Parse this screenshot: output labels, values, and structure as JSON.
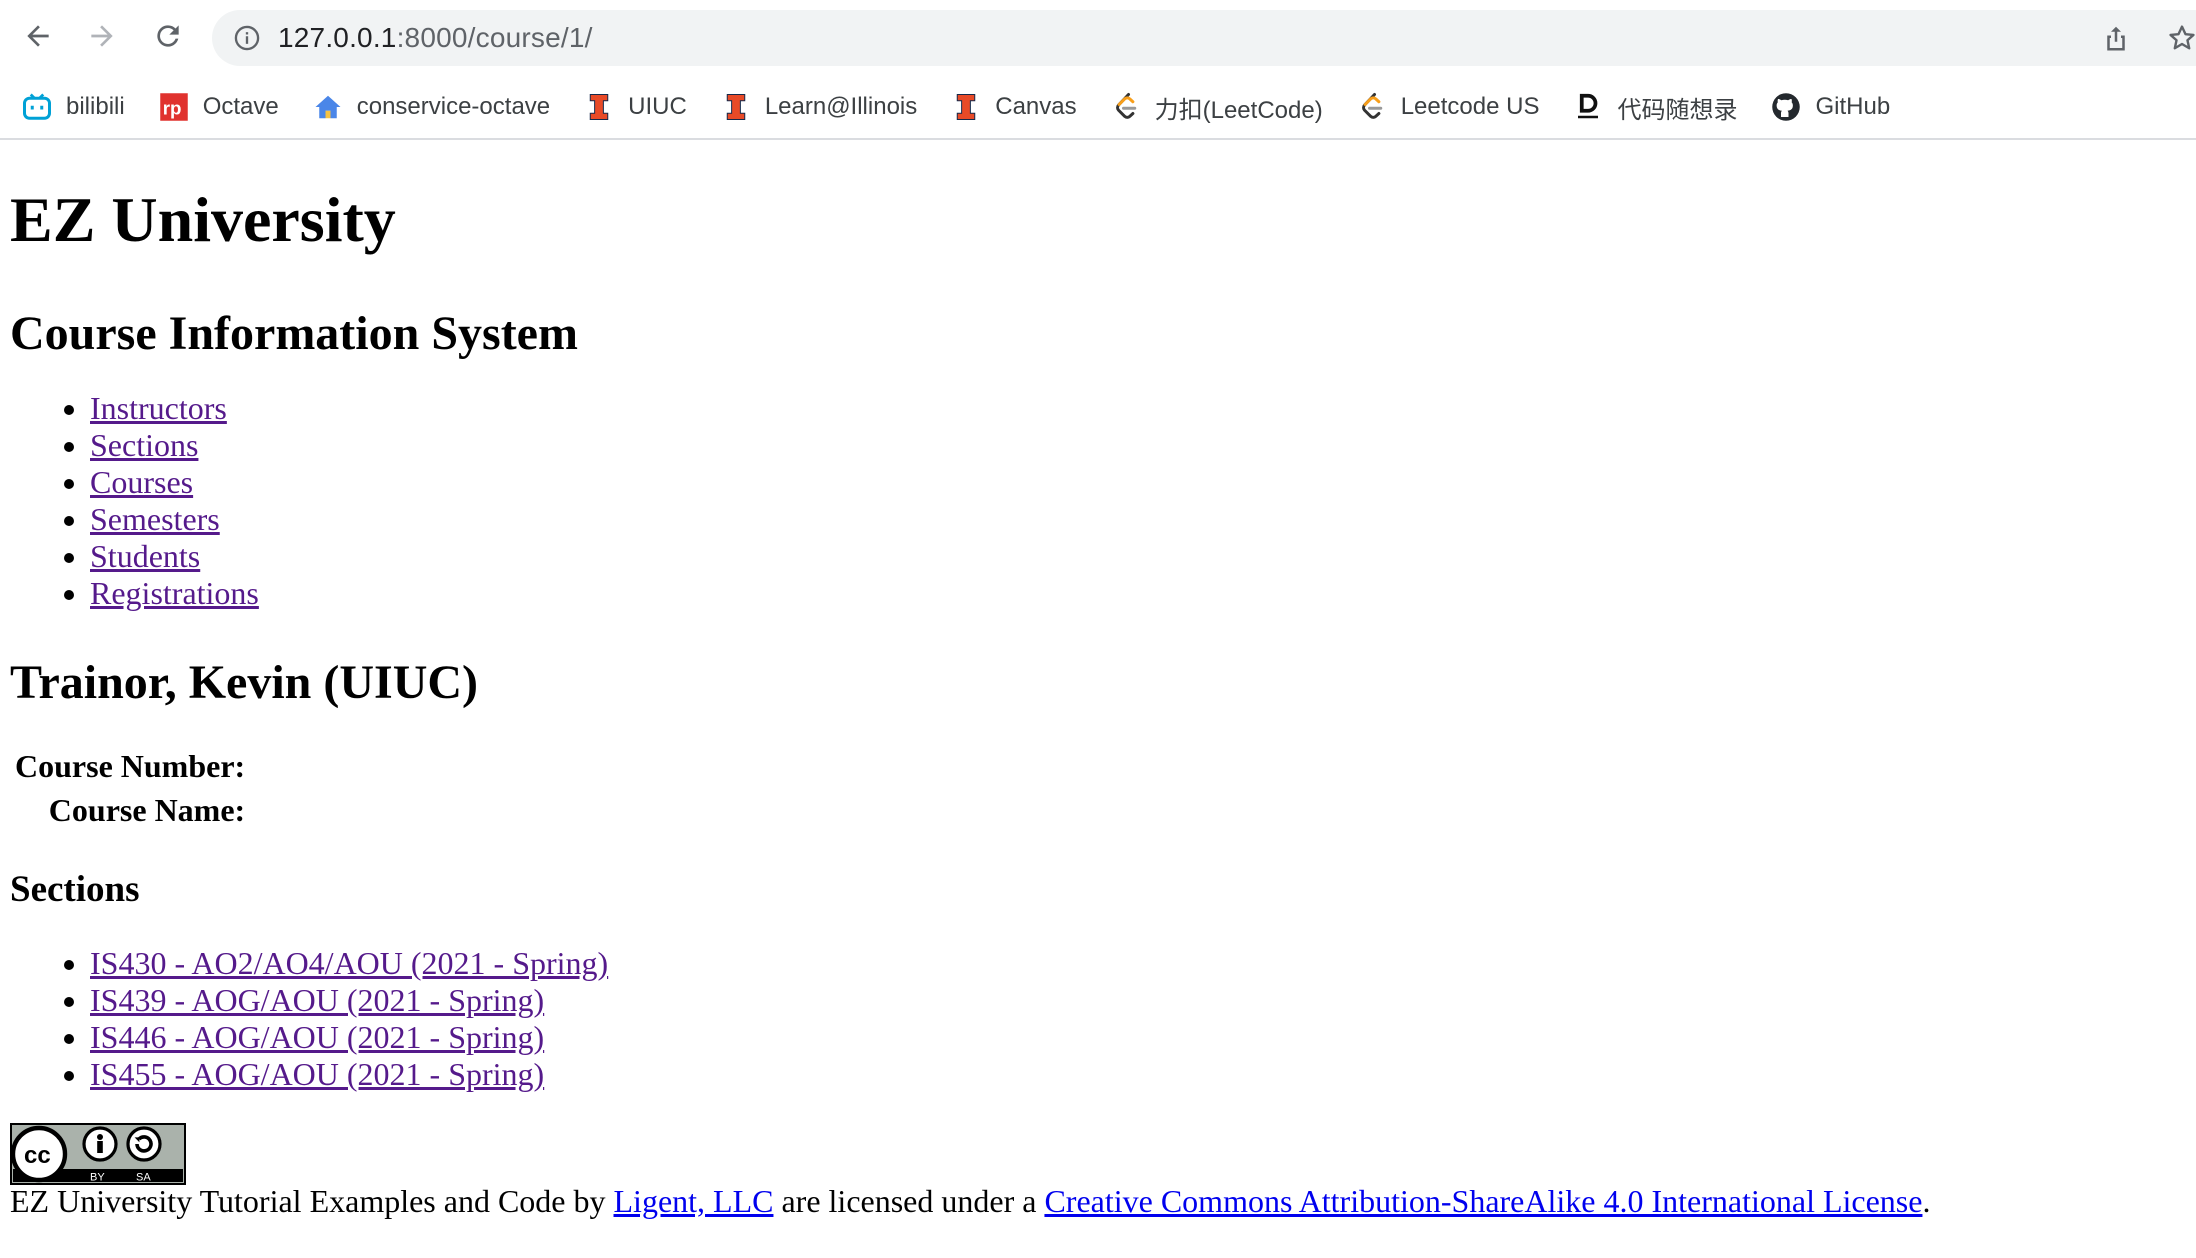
{
  "browser": {
    "url_host": "127.0.0.1",
    "url_path": ":8000/course/1/",
    "bookmarks": [
      {
        "label": "bilibili",
        "icon": "bilibili-icon"
      },
      {
        "label": "Octave",
        "icon": "octave-icon"
      },
      {
        "label": "conservice-octave",
        "icon": "home-icon"
      },
      {
        "label": "UIUC",
        "icon": "illinois-icon"
      },
      {
        "label": "Learn@Illinois",
        "icon": "illinois-icon"
      },
      {
        "label": "Canvas",
        "icon": "illinois-icon"
      },
      {
        "label": "力扣(LeetCode)",
        "icon": "leetcode-icon"
      },
      {
        "label": "Leetcode US",
        "icon": "leetcode-icon"
      },
      {
        "label": "代码随想录",
        "icon": "daima-icon"
      },
      {
        "label": "GitHub",
        "icon": "github-icon"
      }
    ]
  },
  "site": {
    "title": "EZ University",
    "subtitle": "Course Information System",
    "nav": [
      "Instructors",
      "Sections",
      "Courses",
      "Semesters",
      "Students",
      "Registrations"
    ]
  },
  "detail": {
    "heading": "Trainor, Kevin (UIUC)",
    "course_number_label": "Course Number:",
    "course_name_label": "Course Name:"
  },
  "sections": {
    "heading": "Sections",
    "items": [
      "IS430 - AO2/AO4/AOU (2021 - Spring)",
      "IS439 - AOG/AOU (2021 - Spring)",
      "IS446 - AOG/AOU (2021 - Spring)",
      "IS455 - AOG/AOU (2021 - Spring)"
    ]
  },
  "footer": {
    "badge_text": "cc by sa",
    "text_before": "EZ University Tutorial Examples and Code by ",
    "author_link": "Ligent, LLC",
    "text_middle": " are licensed under a ",
    "license_link": "Creative Commons Attribution-ShareAlike 4.0 International License",
    "text_after": "."
  },
  "colors": {
    "visited_link": "#551a8b",
    "unvisited_link": "#0000ee",
    "illinois_orange": "#e84a27",
    "bilibili_blue": "#00a1d6"
  }
}
